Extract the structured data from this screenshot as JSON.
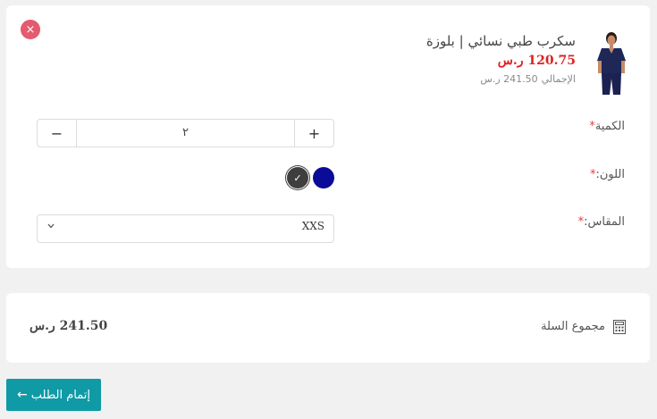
{
  "product": {
    "name": "سكرب طبي نسائي | بلوزة",
    "price": "120.75 ر.س",
    "total_label": "الإجمالي",
    "total_value": "241.50 ر.س",
    "image_icon": "scrub-top-product-image"
  },
  "quantity": {
    "label": "الكمية",
    "value": "٢",
    "increment": "+",
    "decrement": "−"
  },
  "color": {
    "label": "اللون:",
    "options": [
      {
        "name": "navy",
        "hex": "#0b0b99",
        "selected": false
      },
      {
        "name": "charcoal",
        "hex": "#3e3e3e",
        "selected": true
      }
    ],
    "check_glyph": "✓"
  },
  "size": {
    "label": "المقاس:",
    "selected": "XXS"
  },
  "required_marker": "*",
  "remove_glyph": "×",
  "cart": {
    "total_label": "مجموع السلة",
    "total_value": "241.50 ر.س"
  },
  "checkout": {
    "label": "إتمام الطلب",
    "arrow": "←"
  },
  "colors": {
    "accent": "#0f9aa6",
    "price_red": "#e02020",
    "remove_red": "#e45a6e"
  }
}
